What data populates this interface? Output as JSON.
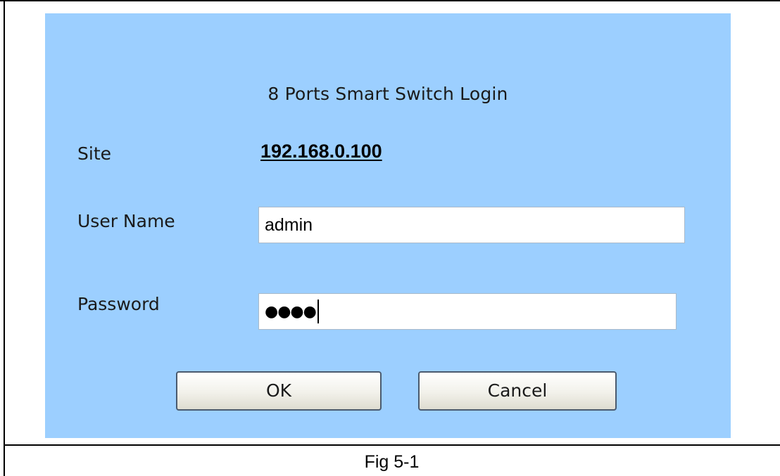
{
  "dialog": {
    "title": "8 Ports Smart Switch Login",
    "site_label": "Site",
    "site_value": "192.168.0.100",
    "username_label": "User Name",
    "username_value": "admin",
    "password_label": "Password",
    "password_masked": "●●●●",
    "ok_label": "OK",
    "cancel_label": "Cancel"
  },
  "figure": {
    "caption": "Fig 5-1"
  },
  "colors": {
    "panel_background": "#9ccfff"
  }
}
